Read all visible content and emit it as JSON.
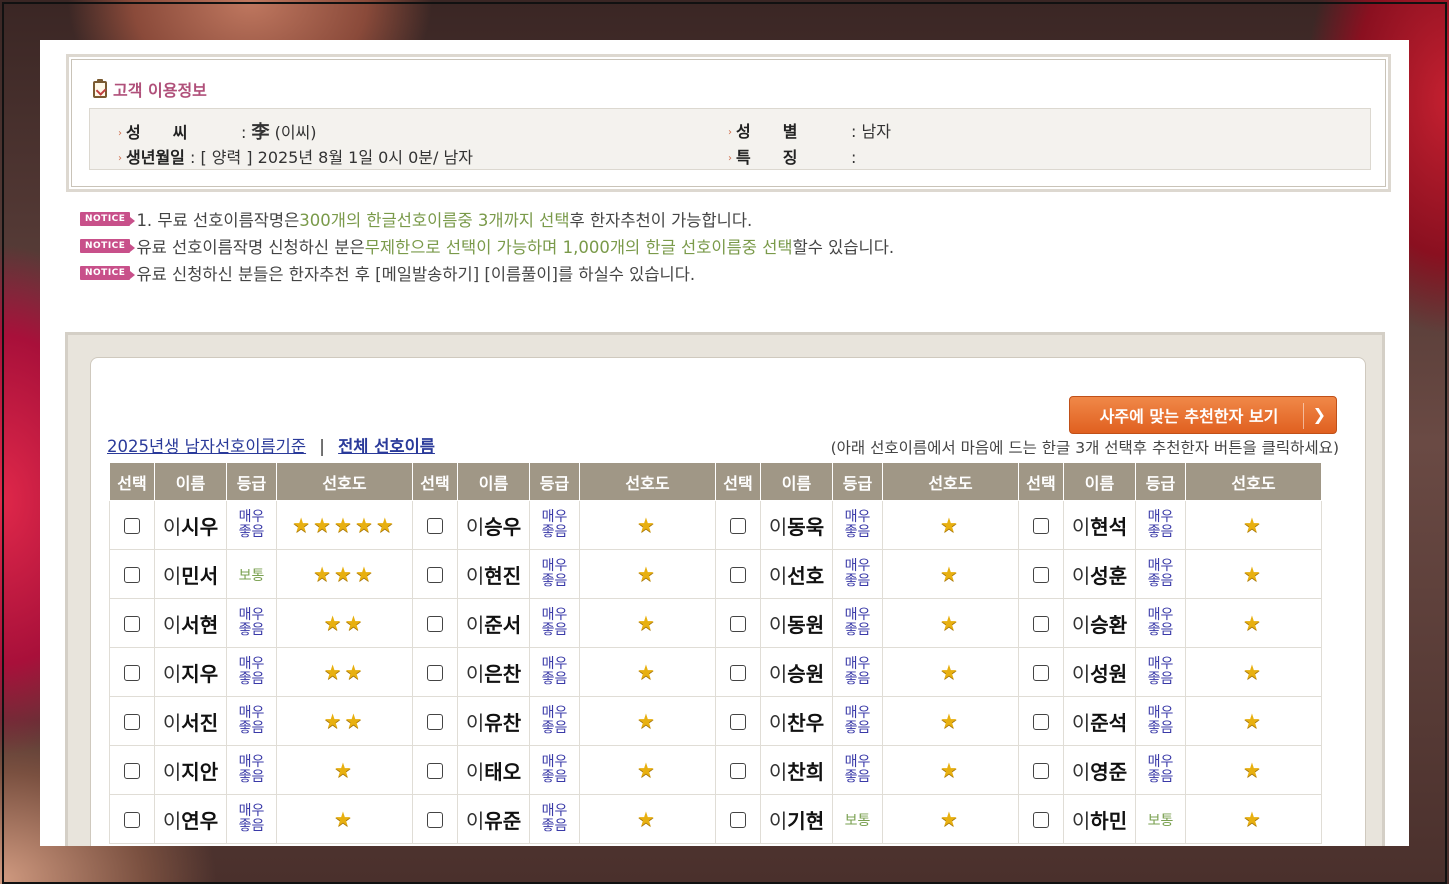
{
  "customer_info": {
    "title": "고객 이용정보",
    "surname_label": "성　　씨",
    "surname_value_hanja": "李",
    "surname_value_reading": "(이씨)",
    "birth_label": "생년월일",
    "birth_value": "[ 양력 ] 2025년 8월 1일 0시 0분/ 남자",
    "gender_label": "성　　별",
    "gender_value": "남자",
    "feature_label": "특　　징",
    "feature_value": ""
  },
  "notice_badge": "NOTICE",
  "notices": [
    {
      "a": "1. 무료 선호이름작명은 ",
      "b": "300개의 한글선호이름중 3개까지 선택",
      "c": "후 한자추천이 가능합니다.",
      "d": "",
      "e": ""
    },
    {
      "a": "유료 선호이름작명 신청하신 분은",
      "b": "무제한으로 선택이 가능하며 1,000개의 한글 선호이름중 선택",
      "c": "할수 있습니다.",
      "d": "",
      "e": ""
    },
    {
      "a": "유료 신청하신 분들은 한자추천 후 [메일발송하기] [이름풀이]를 하실수 있습니다.",
      "b": "",
      "c": "",
      "d": "",
      "e": ""
    }
  ],
  "recommend_button": "사주에 맞는 추천한자 보기",
  "filter_link_1": "2025년생 남자선호이름기준",
  "filter_separator": "|",
  "filter_link_2": "전체 선호이름",
  "hint_text": "(아래 선호이름에서 마음에 드는 한글 3개 선택후 추천한자 버튼을 클릭하세요)",
  "table_headers": {
    "select": "선택",
    "name": "이름",
    "grade": "등급",
    "preference": "선호도"
  },
  "surname": "이",
  "grades": {
    "very_good": "매우좋음",
    "normal": "보통"
  },
  "name_rows": [
    [
      {
        "given": "시우",
        "grade": "매우좋음",
        "stars": 5
      },
      {
        "given": "승우",
        "grade": "매우좋음",
        "stars": 1
      },
      {
        "given": "동욱",
        "grade": "매우좋음",
        "stars": 1
      },
      {
        "given": "현석",
        "grade": "매우좋음",
        "stars": 1
      }
    ],
    [
      {
        "given": "민서",
        "grade": "보통",
        "stars": 3
      },
      {
        "given": "현진",
        "grade": "매우좋음",
        "stars": 1
      },
      {
        "given": "선호",
        "grade": "매우좋음",
        "stars": 1
      },
      {
        "given": "성훈",
        "grade": "매우좋음",
        "stars": 1
      }
    ],
    [
      {
        "given": "서현",
        "grade": "매우좋음",
        "stars": 2
      },
      {
        "given": "준서",
        "grade": "매우좋음",
        "stars": 1
      },
      {
        "given": "동원",
        "grade": "매우좋음",
        "stars": 1
      },
      {
        "given": "승환",
        "grade": "매우좋음",
        "stars": 1
      }
    ],
    [
      {
        "given": "지우",
        "grade": "매우좋음",
        "stars": 2
      },
      {
        "given": "은찬",
        "grade": "매우좋음",
        "stars": 1
      },
      {
        "given": "승원",
        "grade": "매우좋음",
        "stars": 1
      },
      {
        "given": "성원",
        "grade": "매우좋음",
        "stars": 1
      }
    ],
    [
      {
        "given": "서진",
        "grade": "매우좋음",
        "stars": 2
      },
      {
        "given": "유찬",
        "grade": "매우좋음",
        "stars": 1
      },
      {
        "given": "찬우",
        "grade": "매우좋음",
        "stars": 1
      },
      {
        "given": "준석",
        "grade": "매우좋음",
        "stars": 1
      }
    ],
    [
      {
        "given": "지안",
        "grade": "매우좋음",
        "stars": 1
      },
      {
        "given": "태오",
        "grade": "매우좋음",
        "stars": 1
      },
      {
        "given": "찬희",
        "grade": "매우좋음",
        "stars": 1
      },
      {
        "given": "영준",
        "grade": "매우좋음",
        "stars": 1
      }
    ],
    [
      {
        "given": "연우",
        "grade": "매우좋음",
        "stars": 1
      },
      {
        "given": "유준",
        "grade": "매우좋음",
        "stars": 1
      },
      {
        "given": "기현",
        "grade": "보통",
        "stars": 1
      },
      {
        "given": "하민",
        "grade": "보통",
        "stars": 1
      }
    ]
  ],
  "colors": {
    "accent_pink": "#c8508a",
    "button_orange": "#e8702e",
    "header_gray": "#a09786",
    "grade_blue": "#3a3aa8",
    "grade_green": "#7aa050",
    "star_gold": "#e8b010"
  }
}
